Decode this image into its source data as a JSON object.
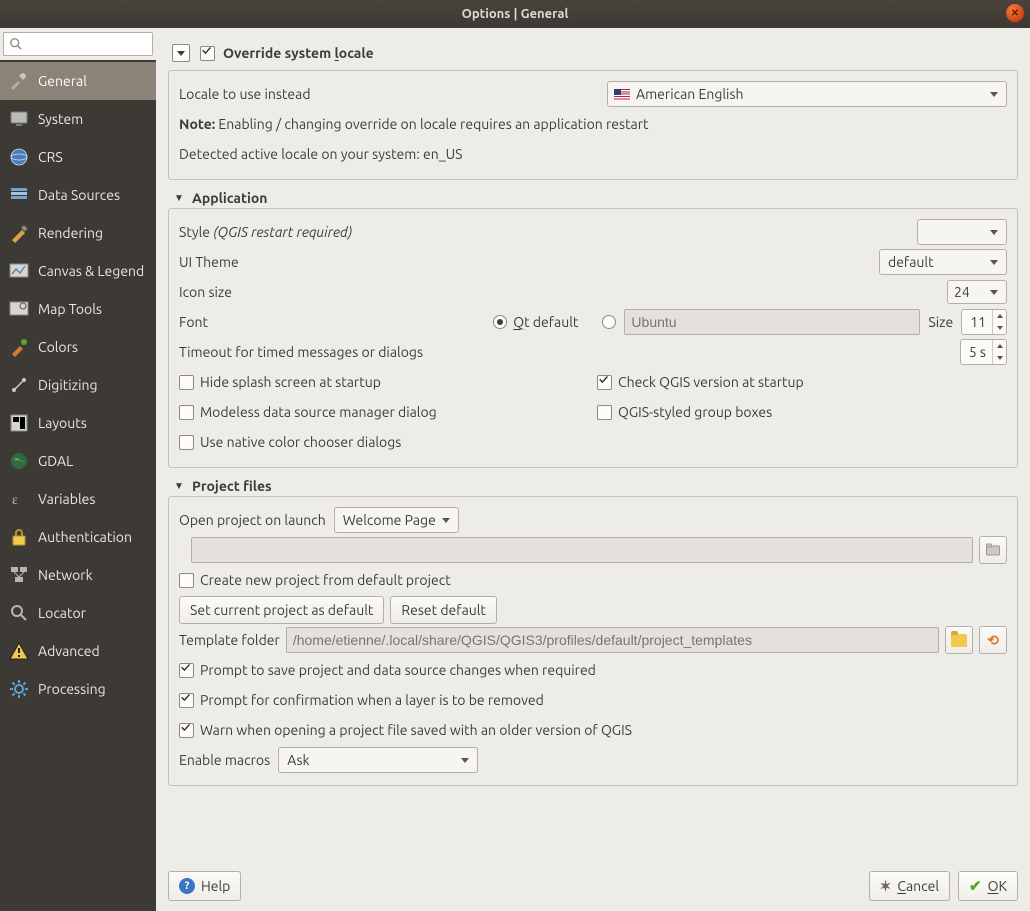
{
  "titlebar": {
    "title": "Options | General"
  },
  "sidebar": {
    "search_placeholder": "",
    "items": [
      {
        "label": "General",
        "icon": "wrench-screwdriver-icon"
      },
      {
        "label": "System",
        "icon": "system-icon"
      },
      {
        "label": "CRS",
        "icon": "globe-icon"
      },
      {
        "label": "Data Sources",
        "icon": "data-sources-icon"
      },
      {
        "label": "Rendering",
        "icon": "rendering-icon"
      },
      {
        "label": "Canvas & Legend",
        "icon": "canvas-legend-icon"
      },
      {
        "label": "Map Tools",
        "icon": "map-tools-icon"
      },
      {
        "label": "Colors",
        "icon": "colors-icon"
      },
      {
        "label": "Digitizing",
        "icon": "digitizing-icon"
      },
      {
        "label": "Layouts",
        "icon": "layouts-icon"
      },
      {
        "label": "GDAL",
        "icon": "gdal-icon"
      },
      {
        "label": "Variables",
        "icon": "variables-icon"
      },
      {
        "label": "Authentication",
        "icon": "lock-icon"
      },
      {
        "label": "Network",
        "icon": "network-icon"
      },
      {
        "label": "Locator",
        "icon": "search-icon"
      },
      {
        "label": "Advanced",
        "icon": "warning-icon"
      },
      {
        "label": "Processing",
        "icon": "gear-icon"
      }
    ],
    "active_index": 0
  },
  "locale": {
    "override_label": "Override system locale",
    "locale_to_use_label": "Locale to use instead",
    "locale_to_use_value": "American English",
    "note_prefix": "Note:",
    "note_text": " Enabling / changing override on locale requires an application restart",
    "detected_label": "Detected active locale on your system: en_US"
  },
  "application": {
    "header": "Application",
    "style_label": "Style",
    "style_hint": "(QGIS restart required)",
    "style_value": "",
    "ui_theme_label": "UI Theme",
    "ui_theme_value": "default",
    "icon_size_label": "Icon size",
    "icon_size_value": "24",
    "font_label": "Font",
    "font_qt_default": "Qt default",
    "font_family_placeholder": "Ubuntu",
    "font_size_label": "Size",
    "font_size_value": "11",
    "timeout_label": "Timeout for timed messages or dialogs",
    "timeout_value": "5 s",
    "hide_splash_label": "Hide splash screen at startup",
    "check_version_label": "Check QGIS version at startup",
    "modeless_dsm_label": "Modeless data source manager dialog",
    "qgis_groupboxes_label": "QGIS-styled group boxes",
    "native_color_label": "Use native color chooser dialogs"
  },
  "project_files": {
    "header": "Project files",
    "open_on_launch_label": "Open project on launch",
    "open_on_launch_value": "Welcome Page",
    "path_value": "",
    "create_from_default_label": "Create new project from default project",
    "set_current_default_btn": "Set current project as default",
    "reset_default_btn": "Reset default",
    "template_folder_label": "Template folder",
    "template_folder_value": "/home/etienne/.local/share/QGIS/QGIS3/profiles/default/project_templates",
    "prompt_save_label": "Prompt to save project and data source changes when required",
    "prompt_remove_label": "Prompt for confirmation when a layer is to be removed",
    "warn_old_version_label": "Warn when opening a project file saved with an older version of QGIS",
    "enable_macros_label": "Enable macros",
    "enable_macros_value": "Ask"
  },
  "footer": {
    "help_label": "Help",
    "cancel_label": "Cancel",
    "ok_label": "OK"
  }
}
